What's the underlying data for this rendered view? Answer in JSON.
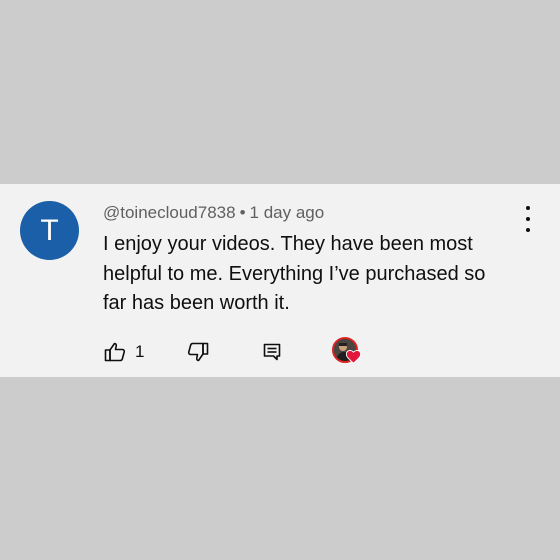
{
  "comment": {
    "avatar_letter": "T",
    "avatar_color": "#1a5fa8",
    "username": "@toinecloud7838",
    "separator": "•",
    "timestamp": "1 day ago",
    "text": "I enjoy your videos. They have been most\nhelpful to me.  Everything I’ve purchased so\nfar has been worth it."
  },
  "actions": {
    "like_icon": "thumbs-up-icon",
    "like_count": "1",
    "dislike_icon": "thumbs-down-icon",
    "reply_icon": "reply-comment-icon",
    "creator_heart_icon": "creator-heart-icon",
    "heart_color": "#e3163c"
  },
  "menu_icon": "more-vertical-icon"
}
